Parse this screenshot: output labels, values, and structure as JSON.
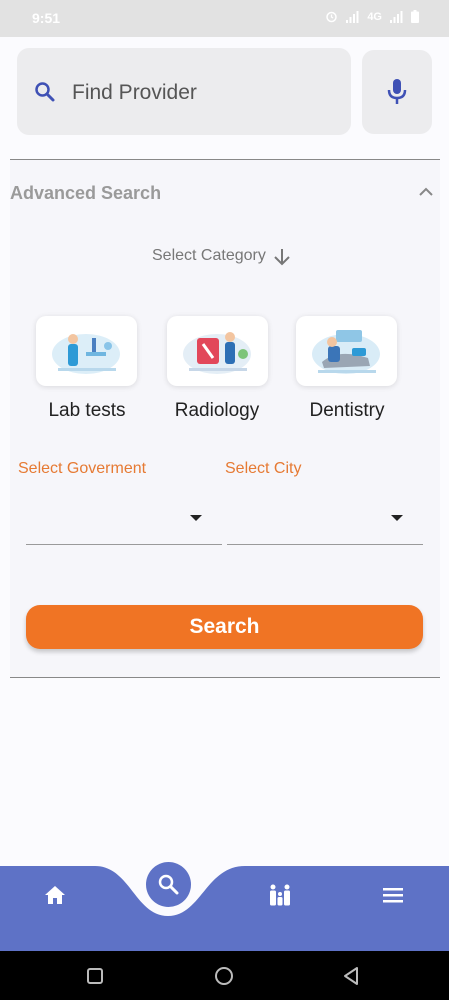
{
  "status_bar": {
    "time": "9:51",
    "network": "4G",
    "icons": [
      "alarm-icon",
      "signal-icon",
      "network-4g",
      "signal-icon",
      "battery-icon"
    ]
  },
  "search": {
    "placeholder": "Find Provider",
    "search_icon": "search-icon",
    "mic_icon": "mic-icon"
  },
  "advanced": {
    "title": "Advanced Search",
    "toggle_icon": "chevron-up-icon",
    "category_label": "Select Category",
    "category_icon": "arrow-down-icon",
    "categories": [
      {
        "label": "Lab tests",
        "image": "lab-tests-illustration"
      },
      {
        "label": "Radiology",
        "image": "radiology-illustration"
      },
      {
        "label": "Dentistry",
        "image": "dentistry-illustration"
      }
    ],
    "government_label": "Select Goverment",
    "government_value": "",
    "city_label": "Select City",
    "city_value": "",
    "search_button": "Search"
  },
  "bottom_nav": {
    "items": [
      "home-icon",
      "search-icon",
      "family-icon",
      "menu-icon"
    ],
    "active": "search-icon"
  },
  "system_nav": [
    "recents-icon",
    "home-circle-icon",
    "back-icon"
  ],
  "colors": {
    "accent": "#f07424",
    "nav": "#5e72c6",
    "search_icon": "#3f51b5",
    "label_orange": "#e67a33"
  }
}
